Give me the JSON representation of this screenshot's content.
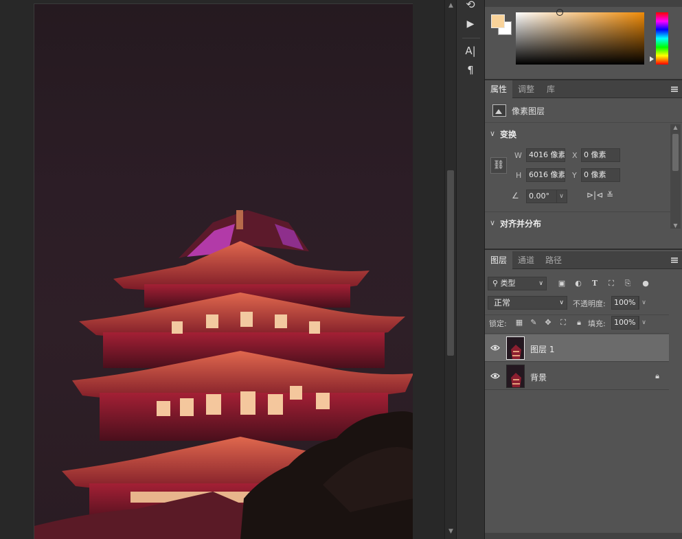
{
  "tool_strip": {
    "items": [
      {
        "name": "history-icon",
        "glyph": "⟲"
      },
      {
        "name": "play-icon",
        "glyph": "▶"
      },
      {
        "name": "character-icon",
        "glyph": "A|"
      },
      {
        "name": "paragraph-icon",
        "glyph": "¶"
      }
    ]
  },
  "color": {
    "foreground": "#f9d39a",
    "background": "#ffffff",
    "picker_hue": "#ef8b08"
  },
  "properties": {
    "tabs": [
      {
        "label": "属性",
        "active": true
      },
      {
        "label": "调整",
        "active": false
      },
      {
        "label": "库",
        "active": false
      }
    ],
    "layer_kind": "像素图层",
    "transform_title": "变换",
    "w_label": "W",
    "w_value": "4016 像素",
    "x_label": "X",
    "x_value": "0 像素",
    "h_label": "H",
    "h_value": "6016 像素",
    "y_label": "Y",
    "y_value": "0 像素",
    "angle_value": "0.00°",
    "align_title": "对齐并分布"
  },
  "layers": {
    "tabs": [
      {
        "label": "图层",
        "active": true
      },
      {
        "label": "通道",
        "active": false
      },
      {
        "label": "路径",
        "active": false
      }
    ],
    "filter_kind": "类型",
    "blend_mode": "正常",
    "opacity_label": "不透明度:",
    "opacity_value": "100%",
    "lock_label": "锁定:",
    "fill_label": "填充:",
    "fill_value": "100%",
    "items": [
      {
        "name": "图层 1",
        "selected": true,
        "visible": true,
        "locked": false
      },
      {
        "name": "背景",
        "selected": false,
        "visible": true,
        "locked": true
      }
    ]
  }
}
